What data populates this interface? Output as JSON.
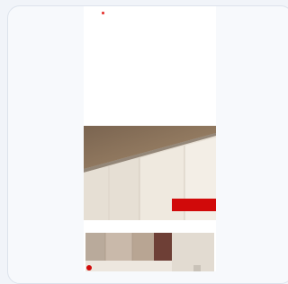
{
  "hero": {
    "badge_title": "",
    "badge_subtitle": ""
  },
  "section": {
    "title": ""
  },
  "colors": {
    "brand_red": "#d10a0a",
    "background": "#f1f4f9",
    "card": "#f7f9fc"
  },
  "icons": {
    "brand_logo": "red-circle-logo"
  }
}
